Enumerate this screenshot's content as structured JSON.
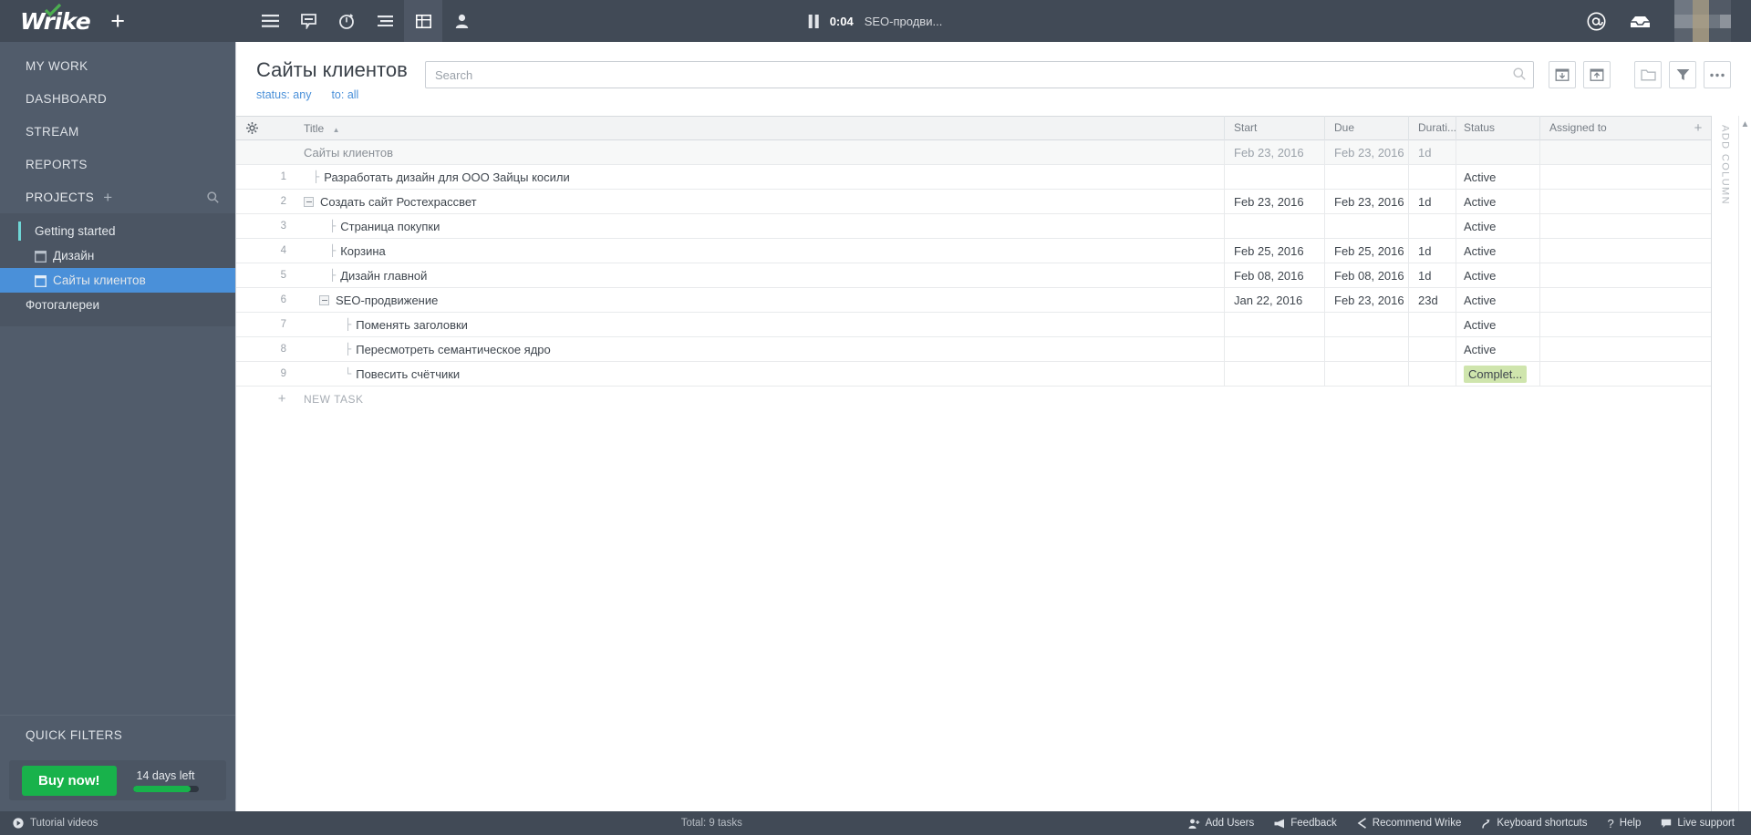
{
  "topbar": {
    "logo_text": "Wrike",
    "new_label": "+",
    "nav": [
      {
        "name": "hamburger-icon",
        "label": "Menu",
        "active": false
      },
      {
        "name": "chat-icon",
        "label": "Chat",
        "active": false
      },
      {
        "name": "timer-icon",
        "label": "Timer",
        "active": false
      },
      {
        "name": "list-view-icon",
        "label": "List view",
        "active": false
      },
      {
        "name": "table-view-icon",
        "label": "Table view",
        "active": true
      },
      {
        "name": "person-icon",
        "label": "People",
        "active": false
      }
    ],
    "timer": {
      "state": "paused",
      "time": "0:04",
      "task": "SEO-продви..."
    },
    "right": [
      {
        "name": "mentions-icon",
        "label": "@"
      },
      {
        "name": "inbox-icon",
        "label": "Inbox"
      }
    ]
  },
  "sidebar": {
    "items": [
      {
        "label": "MY WORK"
      },
      {
        "label": "DASHBOARD"
      },
      {
        "label": "STREAM"
      },
      {
        "label": "REPORTS"
      },
      {
        "label": "PROJECTS",
        "plus": "+",
        "has_search": true
      }
    ],
    "projects": [
      {
        "label": "Getting started",
        "selected": false,
        "accent": true,
        "folder": false
      },
      {
        "label": "Дизайн",
        "selected": false,
        "accent": false,
        "folder": true
      },
      {
        "label": "Сайты клиентов",
        "selected": true,
        "accent": false,
        "folder": true
      },
      {
        "label": "Фотогалереи",
        "selected": false,
        "accent": false,
        "folder": false
      }
    ],
    "quick_filters_label": "QUICK FILTERS",
    "trial": {
      "buy_label": "Buy now!",
      "days_left": "14 days left",
      "progress_pct": 88
    }
  },
  "main": {
    "title": "Сайты клиентов",
    "filters": [
      {
        "label": "status: any"
      },
      {
        "label": "to: all"
      }
    ],
    "search": {
      "value": "",
      "placeholder": "Search"
    },
    "tools": [
      {
        "name": "import-icon",
        "label": "Import"
      },
      {
        "name": "export-icon",
        "label": "Export"
      },
      {
        "name": "folder-icon",
        "label": "Folder"
      },
      {
        "name": "filter-icon",
        "label": "Filter"
      },
      {
        "name": "more-icon",
        "label": "..."
      }
    ],
    "table": {
      "columns": [
        {
          "key": "title",
          "label": "Title",
          "sorted": true,
          "sort_dir": "asc"
        },
        {
          "key": "start",
          "label": "Start"
        },
        {
          "key": "due",
          "label": "Due"
        },
        {
          "key": "duration",
          "label": "Durati..."
        },
        {
          "key": "status",
          "label": "Status"
        },
        {
          "key": "assigned",
          "label": "Assigned to"
        }
      ],
      "add_column_label": "ADD COLUMN",
      "add_column_plus": "+",
      "rows": [
        {
          "num": "",
          "title": "Сайты клиентов",
          "indent": 0,
          "group": true,
          "collapse": false,
          "tree": false,
          "start": "Feb 23, 2016",
          "due": "Feb 23, 2016",
          "duration": "1d",
          "status": "",
          "assigned": ""
        },
        {
          "num": "1",
          "title": "Разработать дизайн для ООО Зайцы косили",
          "indent": 1,
          "group": false,
          "collapse": false,
          "tree": true,
          "start": "",
          "due": "",
          "duration": "",
          "status": "Active",
          "assigned": ""
        },
        {
          "num": "2",
          "title": "Создать сайт Ростехрассвет",
          "indent": 0,
          "group": false,
          "collapse": true,
          "tree": false,
          "start": "Feb 23, 2016",
          "due": "Feb 23, 2016",
          "duration": "1d",
          "status": "Active",
          "assigned": ""
        },
        {
          "num": "3",
          "title": "Страница покупки",
          "indent": 2,
          "group": false,
          "collapse": false,
          "tree": true,
          "start": "",
          "due": "",
          "duration": "",
          "status": "Active",
          "assigned": ""
        },
        {
          "num": "4",
          "title": "Корзина",
          "indent": 2,
          "group": false,
          "collapse": false,
          "tree": true,
          "start": "Feb 25, 2016",
          "due": "Feb 25, 2016",
          "duration": "1d",
          "status": "Active",
          "assigned": ""
        },
        {
          "num": "5",
          "title": "Дизайн главной",
          "indent": 2,
          "group": false,
          "collapse": false,
          "tree": true,
          "start": "Feb 08, 2016",
          "due": "Feb 08, 2016",
          "duration": "1d",
          "status": "Active",
          "assigned": ""
        },
        {
          "num": "6",
          "title": "SEO-продвижение",
          "indent": 1,
          "group": false,
          "collapse": true,
          "tree": false,
          "start": "Jan 22, 2016",
          "due": "Feb 23, 2016",
          "duration": "23d",
          "status": "Active",
          "assigned": ""
        },
        {
          "num": "7",
          "title": "Поменять заголовки",
          "indent": 3,
          "group": false,
          "collapse": false,
          "tree": true,
          "start": "",
          "due": "",
          "duration": "",
          "status": "Active",
          "assigned": ""
        },
        {
          "num": "8",
          "title": "Пересмотреть семантическое ядро",
          "indent": 3,
          "group": false,
          "collapse": false,
          "tree": true,
          "start": "",
          "due": "",
          "duration": "",
          "status": "Active",
          "assigned": ""
        },
        {
          "num": "9",
          "title": "Повесить счётчики",
          "indent": 3,
          "group": false,
          "collapse": false,
          "tree": true,
          "start": "",
          "due": "",
          "duration": "",
          "status": "Complet...",
          "status_complete": true,
          "assigned": ""
        }
      ],
      "new_task_label": "NEW TASK",
      "new_task_plus": "+"
    }
  },
  "footer": {
    "tutorial_label": "Tutorial videos",
    "total_label": "Total: 9 tasks",
    "links": [
      {
        "name": "add-users",
        "label": "Add Users",
        "icon": "add-users-icon"
      },
      {
        "name": "feedback",
        "label": "Feedback",
        "icon": "megaphone-icon"
      },
      {
        "name": "recommend-wrike",
        "label": "Recommend Wrike",
        "icon": "share-icon"
      },
      {
        "name": "keyboard-shortcuts",
        "label": "Keyboard shortcuts",
        "icon": "keyboard-icon"
      },
      {
        "name": "help",
        "label": "Help",
        "icon": "question-icon"
      },
      {
        "name": "live-support",
        "label": "Live support",
        "icon": "support-icon"
      }
    ]
  },
  "colors": {
    "topbar_bg": "#414a56",
    "sidebar_bg": "#515c6b",
    "selection_blue": "#4a90d9",
    "accent_teal": "#6fd6d6",
    "buy_green": "#18b24b",
    "status_complete_bg": "#cfe5ad",
    "link_blue": "#4a90d9"
  }
}
